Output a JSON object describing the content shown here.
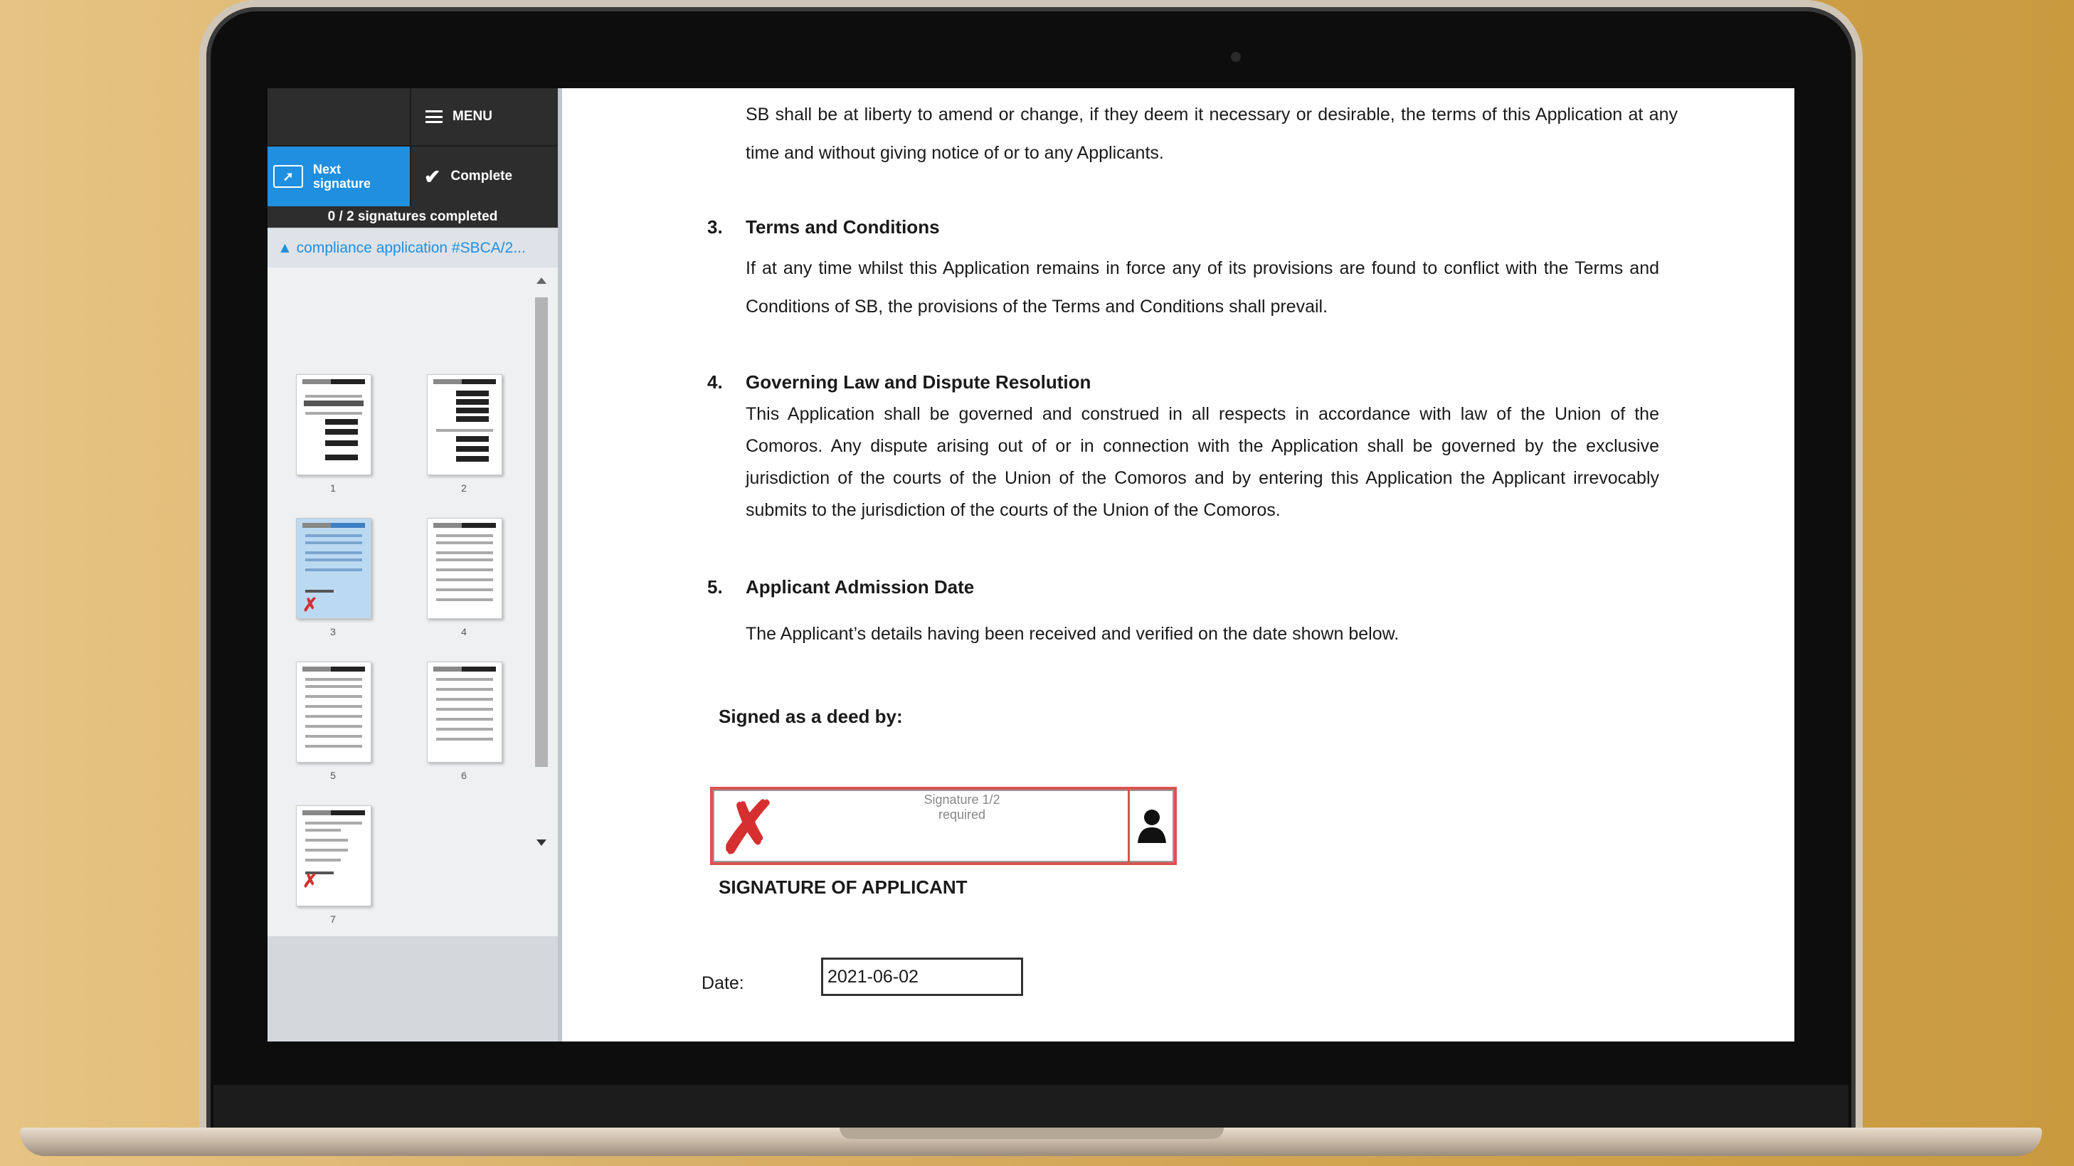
{
  "sidebar": {
    "menu_label": "MENU",
    "next_signature_label": "Next signature",
    "complete_label": "Complete",
    "progress_text": "0 / 2 signatures completed",
    "document_title": "compliance application #SBCA/2...",
    "thumbnails": [
      {
        "page": "1"
      },
      {
        "page": "2"
      },
      {
        "page": "3"
      },
      {
        "page": "4"
      },
      {
        "page": "5"
      },
      {
        "page": "6"
      },
      {
        "page": "7"
      }
    ]
  },
  "document": {
    "intro_paragraph": "SB shall be at liberty to amend or change, if they deem it necessary or desirable, the terms of this Application at any time and without giving notice of or to any Applicants.",
    "sections": [
      {
        "number": "3.",
        "title": "Terms and Conditions",
        "body": "If at any time whilst this Application remains in force any of its provisions are found to conflict with the Terms and Conditions of SB, the provisions of the Terms and Conditions shall prevail."
      },
      {
        "number": "4.",
        "title": "Governing Law and Dispute Resolution",
        "body": "This Application shall be governed and construed in all respects in accordance with law of the Union of the Comoros. Any dispute arising out of or in connection with the Application shall be governed by the exclusive jurisdiction of the courts of the Union of the Comoros and by entering this Application the Applicant irrevocably submits to the jurisdiction of the courts of the Union of the Comoros."
      },
      {
        "number": "5.",
        "title": "Applicant Admission Date",
        "body": "The Applicant’s details having been received and verified on the date shown below."
      }
    ],
    "signed_as_deed": "Signed as a deed by:",
    "signature_field": {
      "status_line1": "Signature 1/2",
      "status_line2": "required"
    },
    "signature_caption": "SIGNATURE OF APPLICANT",
    "date_label": "Date:",
    "date_value": "2021-06-02"
  },
  "colors": {
    "accent": "#1f8fe0",
    "signature_red": "#d62f2f"
  }
}
